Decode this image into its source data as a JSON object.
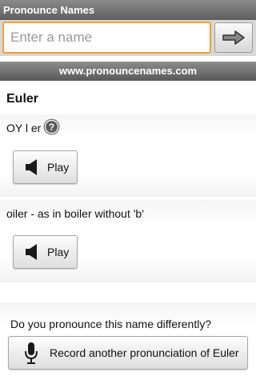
{
  "app": {
    "title": "Pronounce Names"
  },
  "search": {
    "placeholder": "Enter a name",
    "value": ""
  },
  "site": {
    "url": "www.pronouncenames.com"
  },
  "name": "Euler",
  "pronunciations": [
    {
      "text": "OY l er",
      "play_label": "Play",
      "has_help": true
    },
    {
      "text": "oiler - as in boiler without 'b'",
      "play_label": "Play",
      "has_help": false
    }
  ],
  "record": {
    "question": "Do you pronounce this name differently?",
    "button_label": "Record another pronunciation of Euler"
  },
  "icons": {
    "go": "arrow-right-icon",
    "help": "help-icon",
    "speaker": "speaker-icon",
    "mic": "microphone-icon"
  },
  "colors": {
    "input_focus_border": "#f0a030",
    "title_bar": "#6e6e6e",
    "help_circle": "#666666"
  }
}
